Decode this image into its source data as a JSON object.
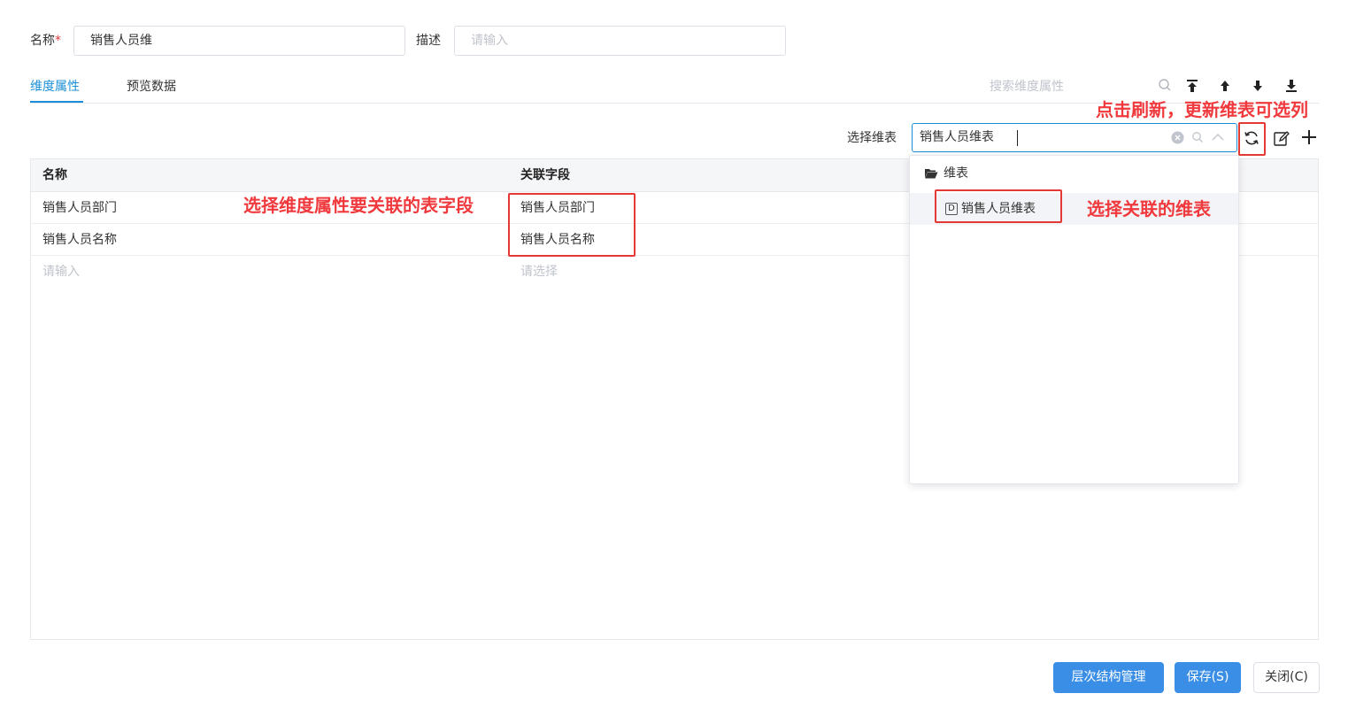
{
  "form": {
    "name_label": "名称",
    "required_mark": "*",
    "name_value": "销售人员维",
    "desc_label": "描述",
    "desc_placeholder": "请输入"
  },
  "tabs": [
    {
      "label": "维度属性",
      "active": true
    },
    {
      "label": "预览数据",
      "active": false
    }
  ],
  "toolbar": {
    "search_placeholder": "搜索维度属性",
    "icons": [
      "search-icon",
      "move-top-icon",
      "move-up-icon",
      "move-down-icon",
      "move-bottom-icon"
    ]
  },
  "dim_select": {
    "label": "选择维表",
    "value": "销售人员维表",
    "icons": [
      "clear-icon",
      "search-icon",
      "chevron-up-icon",
      "refresh-icon",
      "edit-icon",
      "add-icon"
    ]
  },
  "dropdown": {
    "folder": "维表",
    "items": [
      {
        "badge": "D",
        "label": "销售人员维表"
      }
    ]
  },
  "table": {
    "columns": [
      "名称",
      "关联字段"
    ],
    "rows": [
      {
        "name": "销售人员部门",
        "field": "销售人员部门"
      },
      {
        "name": "销售人员名称",
        "field": "销售人员名称"
      }
    ],
    "new_row": {
      "name_placeholder": "请输入",
      "field_placeholder": "请选择"
    }
  },
  "annotations": {
    "refresh_note": "点击刷新，更新维表可选列",
    "field_note": "选择维度属性要关联的表字段",
    "table_note": "选择关联的维表"
  },
  "colors": {
    "accent": "#1a8fd7",
    "primary_button": "#3a8ee6",
    "annotation": "#f0393d"
  },
  "buttons": {
    "hierarchy": "层次结构管理",
    "save": "保存(S)",
    "close": "关闭(C)"
  }
}
